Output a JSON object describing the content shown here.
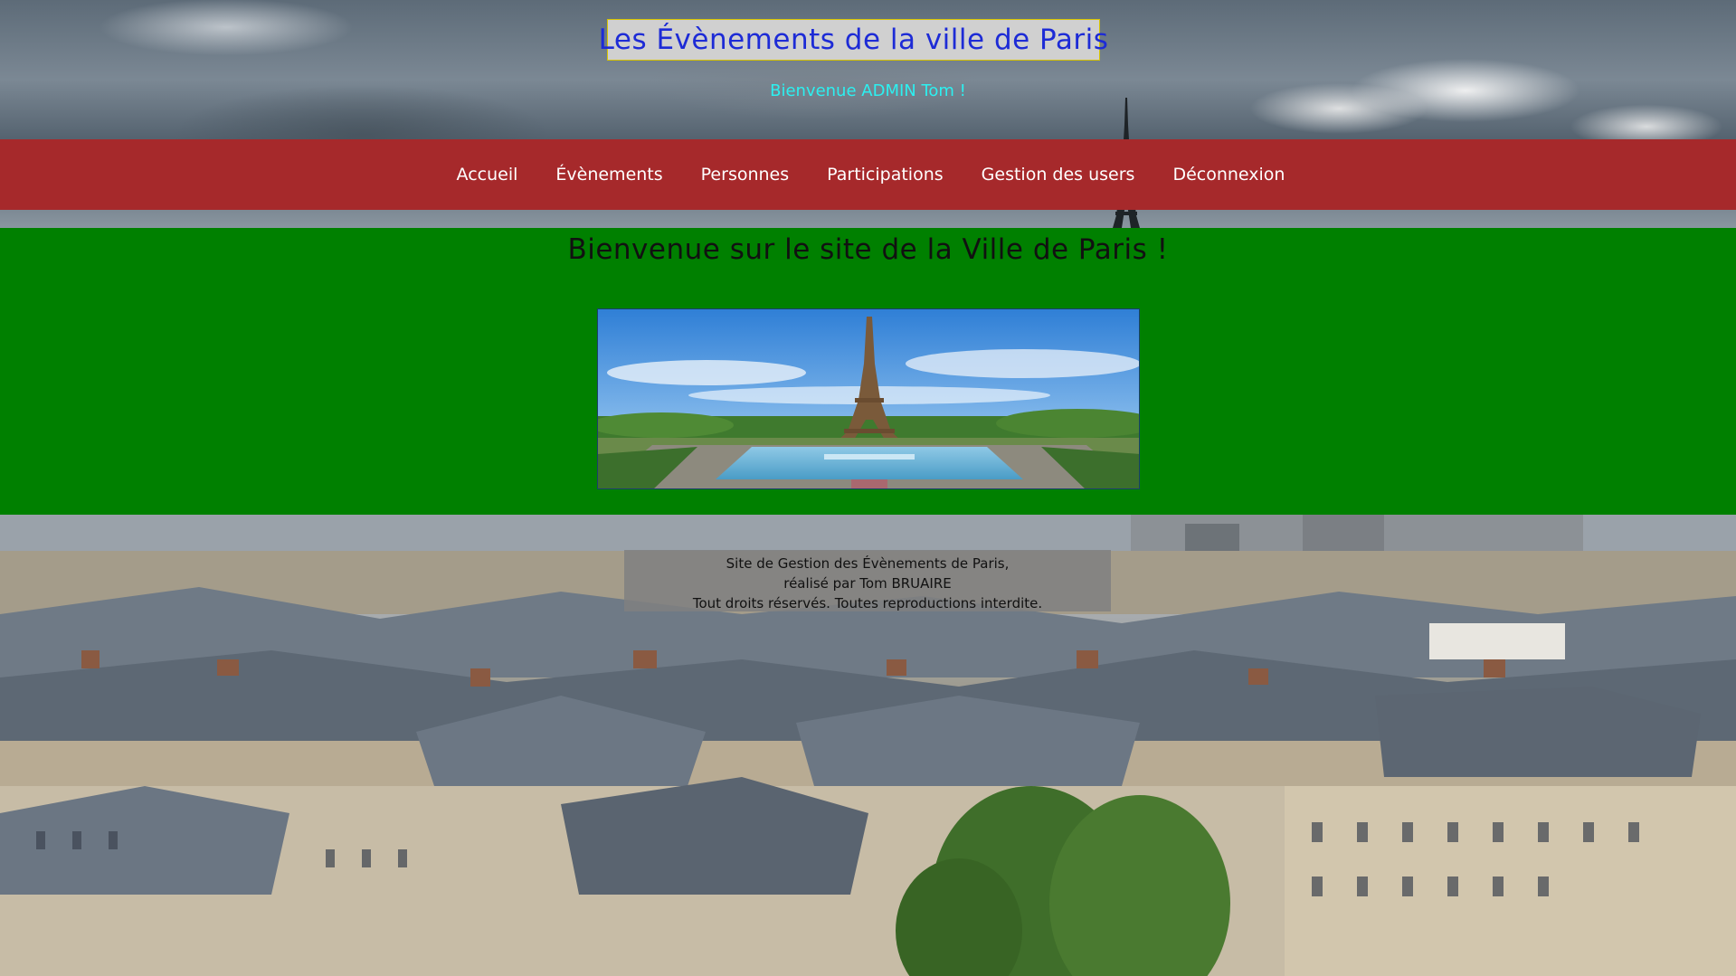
{
  "header": {
    "title": "Les Évènements de la ville de Paris",
    "welcome": "Bienvenue ADMIN Tom !"
  },
  "nav": {
    "items": [
      {
        "label": "Accueil"
      },
      {
        "label": "Évènements"
      },
      {
        "label": "Personnes"
      },
      {
        "label": "Participations"
      },
      {
        "label": "Gestion des users"
      },
      {
        "label": "Déconnexion"
      }
    ]
  },
  "main": {
    "heading": "Bienvenue sur le site de la Ville de Paris !"
  },
  "footer": {
    "line1": "Site de Gestion des Évènements de Paris,",
    "line2": "réalisé par Tom BRUAIRE",
    "line3": "Tout droits réservés. Toutes reproductions interdite."
  },
  "colors": {
    "title_text": "#1d2bd6",
    "welcome_text": "#2cf0f0",
    "nav_background": "#a6292b",
    "main_background": "#008000"
  },
  "images": {
    "header_background": "cloudy-sky-with-eiffel-tower",
    "hero": "eiffel-tower-trocadero-fountains",
    "page_background": "paris-rooftops"
  }
}
